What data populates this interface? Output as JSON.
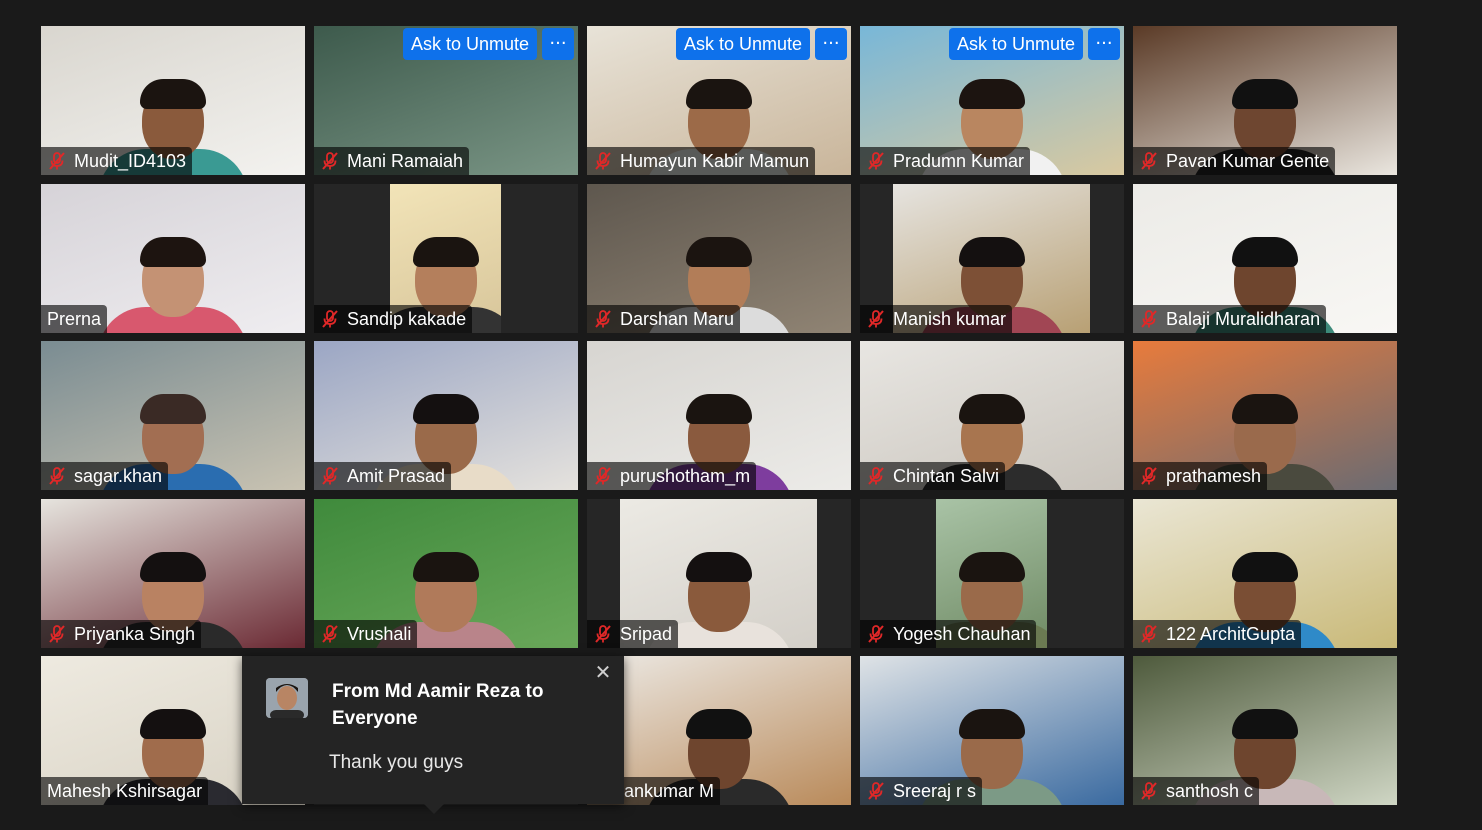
{
  "meeting": {
    "participants": [
      {
        "name": "Mudit_ID4103",
        "muted": true,
        "ask_unmute": false,
        "bg": [
          "#d9d6cf",
          "#f3f2ef"
        ],
        "skin": "#8a5a3c",
        "shirt": "#3a9a93",
        "hair": "#1b1410"
      },
      {
        "name": "Mani Ramaiah",
        "muted": true,
        "ask_unmute": true,
        "bg": [
          "#3d5a4c",
          "#7a9585"
        ],
        "skin": null,
        "shirt": null,
        "hair": null
      },
      {
        "name": "Humayun Kabir Mamun",
        "muted": true,
        "ask_unmute": true,
        "bg": [
          "#e8e3d8",
          "#c9b59a"
        ],
        "skin": "#9c6a48",
        "shirt": "#e8ece8",
        "hair": "#1a1410"
      },
      {
        "name": "Pradumn Kumar",
        "muted": true,
        "ask_unmute": true,
        "bg": [
          "#78b7d8",
          "#d9c9a0"
        ],
        "skin": "#b98660",
        "shirt": "#f1f1f1",
        "hair": "#1c1410"
      },
      {
        "name": "Pavan Kumar Gente",
        "muted": true,
        "ask_unmute": false,
        "bg": [
          "#5a3a26",
          "#eae6df"
        ],
        "skin": "#6e4630",
        "shirt": "#222222",
        "hair": "#111111"
      },
      {
        "name": "Prerna",
        "muted": false,
        "ask_unmute": false,
        "bg": [
          "#d6d3d8",
          "#efedf0"
        ],
        "skin": "#c49274",
        "shirt": "#d8586e",
        "hair": "#1d1410"
      },
      {
        "name": "Sandip kakade",
        "muted": true,
        "ask_unmute": false,
        "bg": [
          "#f2e4b8",
          "#d7c59a"
        ],
        "skin": "#b47f5c",
        "shirt": "#333333",
        "hair": "#1a1410"
      },
      {
        "name": "Darshan Maru",
        "muted": true,
        "ask_unmute": false,
        "bg": [
          "#5e574e",
          "#908474"
        ],
        "skin": "#b27d58",
        "shirt": "#dcdcdc",
        "hair": "#1b1410"
      },
      {
        "name": "Manish kumar",
        "muted": true,
        "ask_unmute": false,
        "bg": [
          "#e6e4e0",
          "#b8a074"
        ],
        "skin": "#7d5036",
        "shirt": "#a14654",
        "hair": "#141010"
      },
      {
        "name": "Balaji Muralidharan",
        "muted": true,
        "ask_unmute": false,
        "bg": [
          "#ecebe7",
          "#f8f7f4"
        ],
        "skin": "#6e452e",
        "shirt": "#3d8a7a",
        "hair": "#111111"
      },
      {
        "name": "sagar.khan",
        "muted": true,
        "ask_unmute": false,
        "bg": [
          "#7a8c92",
          "#c9c3b2"
        ],
        "skin": "#a26e52",
        "shirt": "#2a6db0",
        "hair": "#3a2a25"
      },
      {
        "name": "Amit Prasad",
        "muted": true,
        "ask_unmute": false,
        "bg": [
          "#9ba6c4",
          "#e5e2dd"
        ],
        "skin": "#9a6a4a",
        "shirt": "#e8dcc8",
        "hair": "#141010"
      },
      {
        "name": "purushotham_m",
        "muted": true,
        "ask_unmute": false,
        "bg": [
          "#d7d5d1",
          "#ecebe8"
        ],
        "skin": "#8a5a3e",
        "shirt": "#7e3d9e",
        "hair": "#1a1410"
      },
      {
        "name": "Chintan Salvi",
        "muted": true,
        "ask_unmute": false,
        "bg": [
          "#e8e6e2",
          "#c9c4bc"
        ],
        "skin": "#a8754f",
        "shirt": "#2c2c2c",
        "hair": "#1a1410"
      },
      {
        "name": "prathamesh",
        "muted": true,
        "ask_unmute": false,
        "bg": [
          "#e87b3c",
          "#6b6b72"
        ],
        "skin": "#9a6a4c",
        "shirt": "#4a4a3e",
        "hair": "#1a1410"
      },
      {
        "name": "Priyanka Singh",
        "muted": true,
        "ask_unmute": false,
        "bg": [
          "#e6e4de",
          "#6b2a34"
        ],
        "skin": "#b98262",
        "shirt": "#2a2a2a",
        "hair": "#141010"
      },
      {
        "name": "Vrushali",
        "muted": true,
        "ask_unmute": false,
        "bg": [
          "#3f8a3c",
          "#6aa85a"
        ],
        "skin": "#b07a5a",
        "shirt": "#b9848a",
        "hair": "#1a1410"
      },
      {
        "name": "Sripad",
        "muted": true,
        "ask_unmute": false,
        "bg": [
          "#eceae4",
          "#d3cfc8"
        ],
        "skin": "#8a5a3c",
        "shirt": "#e8e2dc",
        "hair": "#141010"
      },
      {
        "name": "Yogesh Chauhan",
        "muted": true,
        "ask_unmute": false,
        "bg": [
          "#a9c3a6",
          "#6f8a64"
        ],
        "skin": "#9a6a4a",
        "shirt": "#6b7a52",
        "hair": "#1a1410"
      },
      {
        "name": "122 ArchitGupta",
        "muted": true,
        "ask_unmute": false,
        "bg": [
          "#eae6d4",
          "#c9b978"
        ],
        "skin": "#7a4e34",
        "shirt": "#2f8ac8",
        "hair": "#111111"
      },
      {
        "name": "Mahesh Kshirsagar",
        "muted": false,
        "ask_unmute": false,
        "bg": [
          "#eeeae0",
          "#d8d2c4"
        ],
        "skin": "#a06c4c",
        "shirt": "#2a2a30",
        "hair": "#141010"
      },
      {
        "name": "",
        "muted": false,
        "ask_unmute": false,
        "bg": [
          "#262626",
          "#262626"
        ],
        "skin": null,
        "shirt": null,
        "hair": null
      },
      {
        "name": "Pavankumar M",
        "muted": false,
        "ask_unmute": false,
        "bg": [
          "#ece9e4",
          "#b98a5a"
        ],
        "skin": "#6e452e",
        "shirt": "#2a2a2a",
        "hair": "#111111"
      },
      {
        "name": "Sreeraj r s",
        "muted": true,
        "ask_unmute": false,
        "bg": [
          "#dfe3e6",
          "#3a6aa0"
        ],
        "skin": "#9a6a4a",
        "shirt": "#7c9a86",
        "hair": "#1a1410"
      },
      {
        "name": "santhosh c",
        "muted": true,
        "ask_unmute": false,
        "bg": [
          "#4e5a3c",
          "#cfd6c4"
        ],
        "skin": "#6e452e",
        "shirt": "#c8b8b8",
        "hair": "#111111"
      }
    ],
    "ask_unmute_label": "Ask to Unmute",
    "more_label": "···"
  },
  "chat": {
    "header": "From Md Aamir Reza to Everyone",
    "message": "Thank you guys",
    "close_label": "✕"
  },
  "colors": {
    "accent": "#0e71eb",
    "mute_red": "#e02828",
    "background": "#1a1a1a"
  }
}
